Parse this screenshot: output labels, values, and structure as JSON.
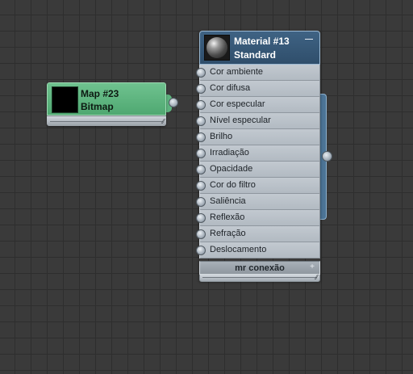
{
  "map_node": {
    "title": "Map #23",
    "subtitle": "Bitmap",
    "header_color": "#5fb880",
    "thumbnail": "black-swatch"
  },
  "material_node": {
    "title": "Material #13",
    "subtitle": "Standard",
    "header_color": "#355777",
    "thumbnail": "material-sphere-icon",
    "collapse_icon": "minus-icon",
    "slots": [
      {
        "label": "Cor ambiente"
      },
      {
        "label": "Cor difusa"
      },
      {
        "label": "Cor especular"
      },
      {
        "label": "Nível especular"
      },
      {
        "label": "Brilho"
      },
      {
        "label": "Irradiação"
      },
      {
        "label": "Opacidade"
      },
      {
        "label": "Cor do filtro"
      },
      {
        "label": "Saliência"
      },
      {
        "label": "Reflexão"
      },
      {
        "label": "Refração"
      },
      {
        "label": "Deslocamento"
      }
    ],
    "mr_connection_label": "mr conexão",
    "expand_icon": "plus-icon"
  },
  "canvas": {
    "background_color": "#3a3a3a",
    "grid_color": "#2e2e2e"
  }
}
